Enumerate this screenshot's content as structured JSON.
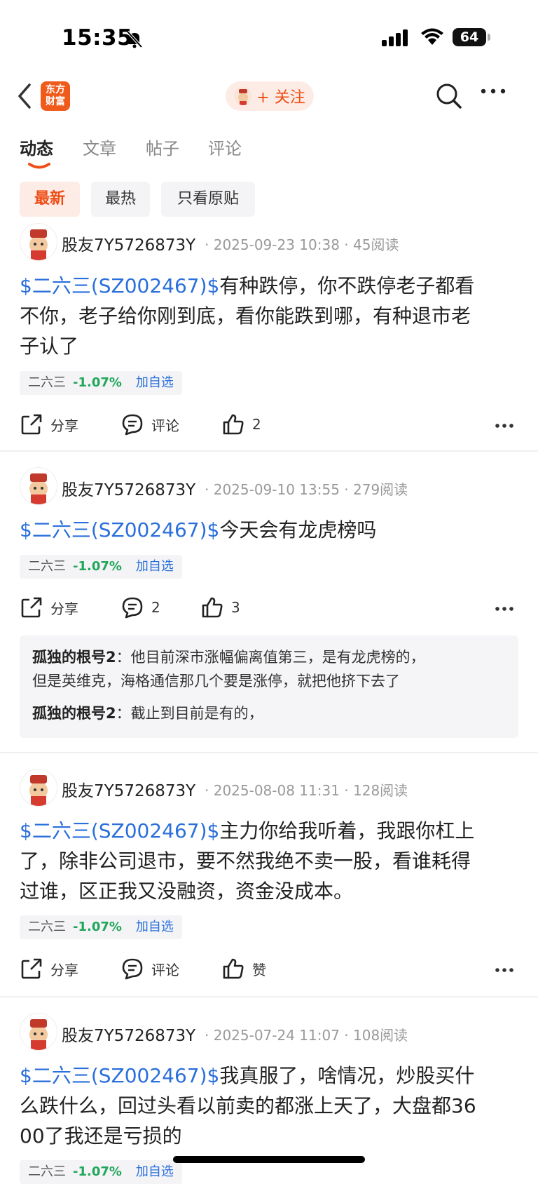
{
  "status_bar": {
    "time": "15:35",
    "battery": "64"
  },
  "header": {
    "logo_line1": "东方",
    "logo_line2": "财富",
    "follow_label": "+ 关注"
  },
  "tabs": [
    "动态",
    "文章",
    "帖子",
    "评论"
  ],
  "filters": [
    "最新",
    "最热",
    "只看原贴"
  ],
  "posts": [
    {
      "author": "股友7Y5726873Y",
      "meta": "· 2025-09-23 10:38 · 45阅读",
      "tag": "$二六三(SZ002467)$",
      "text_line1": "有种跌停，你不跌停老子都看",
      "text_line2": "不你，老子给你刚到底，看你能跌到哪，有种退市老",
      "text_line3": "子认了",
      "stock": {
        "name": "二六三",
        "change": "-1.07%",
        "add": "加自选"
      },
      "actions": {
        "share": "分享",
        "comment": "评论",
        "like": "2"
      }
    },
    {
      "author": "股友7Y5726873Y",
      "meta": "· 2025-09-10 13:55 · 279阅读",
      "tag": "$二六三(SZ002467)$",
      "text_line1": "今天会有龙虎榜吗",
      "stock": {
        "name": "二六三",
        "change": "-1.07%",
        "add": "加自选"
      },
      "actions": {
        "share": "分享",
        "comment": "2",
        "like": "3"
      },
      "comments": [
        {
          "user": "孤独的根号2",
          "sep": "：",
          "line1": "他目前深市涨幅偏离值第三，是有龙虎榜的，",
          "line2": "但是英维克，海格通信那几个要是涨停，就把他挤下去了"
        },
        {
          "user": "孤独的根号2",
          "sep": "：",
          "line1": "截止到目前是有的，"
        }
      ]
    },
    {
      "author": "股友7Y5726873Y",
      "meta": "· 2025-08-08 11:31 · 128阅读",
      "tag": "$二六三(SZ002467)$",
      "text_line1": "主力你给我听着，我跟你杠上",
      "text_line2": "了，除非公司退市，要不然我绝不卖一股，看谁耗得",
      "text_line3": "过谁，区正我又没融资，资金没成本。",
      "stock": {
        "name": "二六三",
        "change": "-1.07%",
        "add": "加自选"
      },
      "actions": {
        "share": "分享",
        "comment": "评论",
        "like": "赞"
      }
    },
    {
      "author": "股友7Y5726873Y",
      "meta": "· 2025-07-24 11:07 · 108阅读",
      "tag": "$二六三(SZ002467)$",
      "text_line1": "我真服了，啥情况，炒股买什",
      "text_line2": "么跌什么，回过头看以前卖的都涨上天了，大盘都36",
      "text_line3": "00了我还是亏损的",
      "stock": {
        "name": "二六三",
        "change": "-1.07%",
        "add": "加自选"
      }
    }
  ],
  "colors": {
    "brand": "#f05a1a",
    "link": "#2a6fdb",
    "down": "#21a65a"
  },
  "icons": [
    "bell-off-icon",
    "signal-icon",
    "wifi-icon",
    "back-icon",
    "search-icon",
    "more-icon",
    "share-icon",
    "comment-icon",
    "like-icon"
  ]
}
